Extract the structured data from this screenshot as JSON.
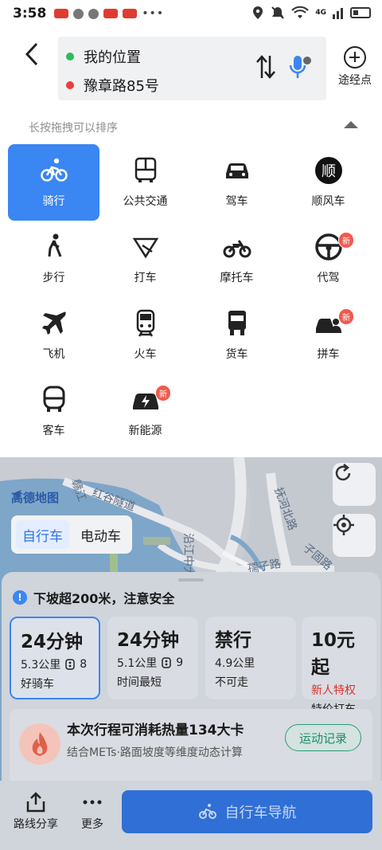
{
  "status_bar": {
    "time": "3:58",
    "network": "4G"
  },
  "route": {
    "start": "我的位置",
    "end": "豫章路85号",
    "waypoint_label": "途经点"
  },
  "hint": "长按拖拽可以排序",
  "modes": [
    {
      "label": "骑行",
      "icon": "bicycle-icon",
      "active": true,
      "badge": ""
    },
    {
      "label": "公共交通",
      "icon": "bus-icon",
      "active": false,
      "badge": ""
    },
    {
      "label": "驾车",
      "icon": "car-icon",
      "active": false,
      "badge": ""
    },
    {
      "label": "顺风车",
      "icon": "shun-icon",
      "active": false,
      "badge": ""
    },
    {
      "label": "步行",
      "icon": "walk-icon",
      "active": false,
      "badge": ""
    },
    {
      "label": "打车",
      "icon": "taxi-icon",
      "active": false,
      "badge": ""
    },
    {
      "label": "摩托车",
      "icon": "motorcycle-icon",
      "active": false,
      "badge": ""
    },
    {
      "label": "代驾",
      "icon": "steering-wheel-icon",
      "active": false,
      "badge": "新"
    },
    {
      "label": "飞机",
      "icon": "airplane-icon",
      "active": false,
      "badge": ""
    },
    {
      "label": "火车",
      "icon": "train-icon",
      "active": false,
      "badge": ""
    },
    {
      "label": "货车",
      "icon": "truck-icon",
      "active": false,
      "badge": ""
    },
    {
      "label": "拼车",
      "icon": "carpool-icon",
      "active": false,
      "badge": "新"
    },
    {
      "label": "客车",
      "icon": "coach-icon",
      "active": false,
      "badge": ""
    },
    {
      "label": "新能源",
      "icon": "ev-car-icon",
      "active": false,
      "badge": "新"
    }
  ],
  "map": {
    "brand": "高德地图",
    "labels": [
      "赣江",
      "红谷隧道",
      "抚河北路",
      "沿江中大道",
      "子固路",
      "孺子路"
    ],
    "toggle": [
      {
        "label": "自行车",
        "active": true
      },
      {
        "label": "电动车",
        "active": false
      }
    ]
  },
  "notice": "下坡超200米，注意安全",
  "route_options": [
    {
      "time": "24分钟",
      "distance": "5.3公里",
      "lights": "8",
      "tag": "好骑车",
      "tag_red": false,
      "selected": true
    },
    {
      "time": "24分钟",
      "distance": "5.1公里",
      "lights": "9",
      "tag": "时间最短",
      "tag_red": false,
      "selected": false
    },
    {
      "time": "禁行",
      "distance": "4.9公里",
      "lights": "",
      "tag": "不可走",
      "tag_red": false,
      "selected": false
    },
    {
      "time": "10元起",
      "distance": "新人特权",
      "lights": "",
      "tag": "特价打车",
      "tag_red": true,
      "selected": false
    }
  ],
  "calorie": {
    "title": "本次行程可消耗热量134大卡",
    "subtitle": "结合METs·路面坡度等维度动态计算",
    "button": "运动记录"
  },
  "bottom": {
    "share_label": "路线分享",
    "more_label": "更多",
    "nav_label": "自行车导航"
  },
  "colors": {
    "accent": "#3a86f2",
    "badge": "#f05a4f",
    "start": "#2dbb5b",
    "end": "#ef3b3b"
  }
}
